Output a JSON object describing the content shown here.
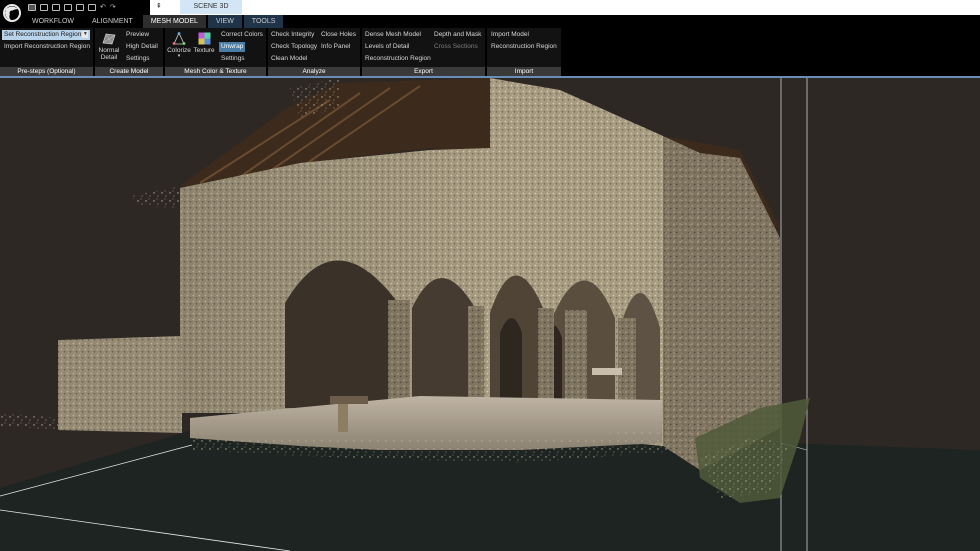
{
  "window": {
    "scene_tab": "SCENE 3D"
  },
  "tabs": [
    {
      "label": "WORKFLOW"
    },
    {
      "label": "ALIGNMENT"
    },
    {
      "label": "MESH MODEL"
    },
    {
      "label": "VIEW"
    },
    {
      "label": "TOOLS"
    }
  ],
  "groups": {
    "presteps": {
      "label": "Pre-steps (Optional)",
      "set_region": "Set Reconstruction Region",
      "import_region": "Import Reconstruction Region"
    },
    "create": {
      "label": "Create Model",
      "normal_detail": "Normal Detail",
      "preview": "Preview",
      "high_detail": "High Detail",
      "settings": "Settings"
    },
    "mesh_color": {
      "label": "Mesh Color & Texture",
      "colorize": "Colorize",
      "texture": "Texture",
      "correct_colors": "Correct Colors",
      "unwrap": "Unwrap",
      "settings": "Settings"
    },
    "analyze": {
      "label": "Analyze",
      "check_integrity": "Check Integrity",
      "check_topology": "Check Topology",
      "clean_model": "Clean Model",
      "close_holes": "Close Holes",
      "info_panel": "Info Panel"
    },
    "export": {
      "label": "Export",
      "dense_mesh": "Dense Mesh Model",
      "levels_of_detail": "Levels of Detail",
      "reconstruction_region": "Reconstruction Region",
      "depth_and_mask": "Depth and Mask",
      "cross_sections": "Cross Sections"
    },
    "import": {
      "label": "Import",
      "import_model": "Import Model",
      "reconstruction_region": "Reconstruction Region"
    }
  },
  "colors": {
    "accent": "#6a8db8",
    "selected_item": "#b9d3ea",
    "viewport_bg": "#2e2824",
    "ground": "#1e2422"
  }
}
